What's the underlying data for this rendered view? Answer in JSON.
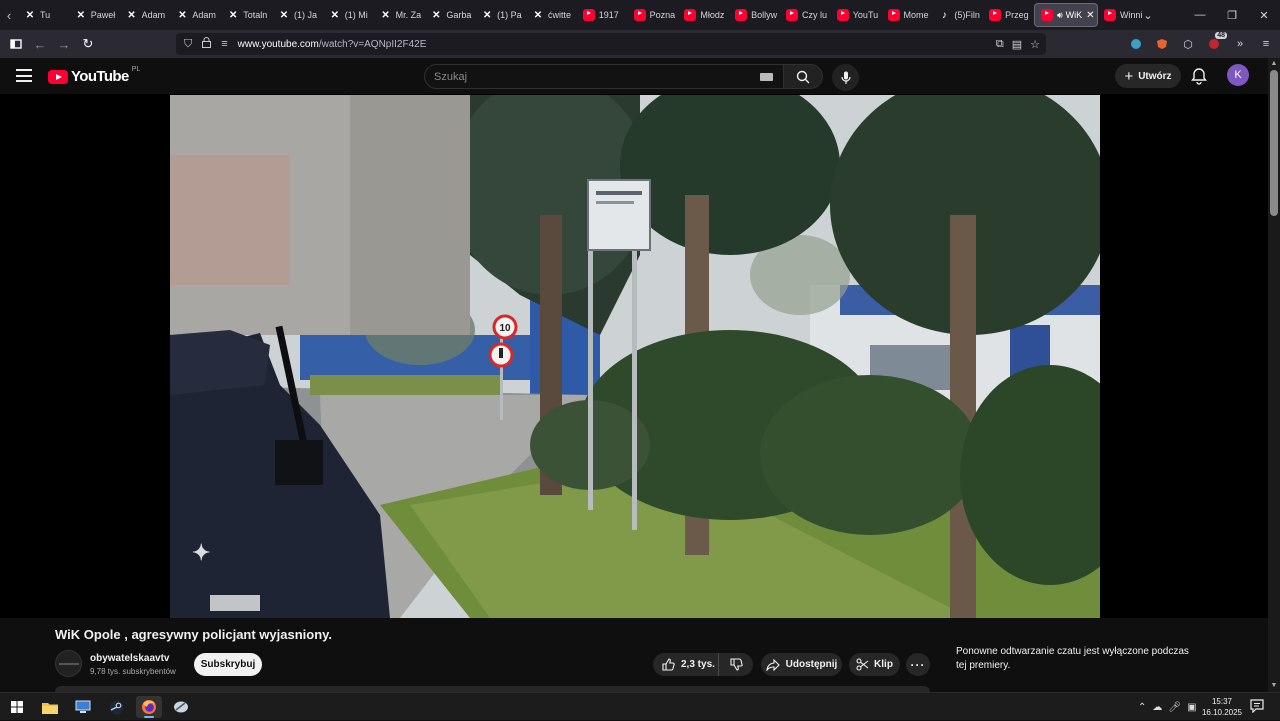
{
  "browser": {
    "tabs": [
      {
        "label": "Tu",
        "icon": "x-icon"
      },
      {
        "label": "Paweł",
        "icon": "x-icon"
      },
      {
        "label": "Adam",
        "icon": "x-icon"
      },
      {
        "label": "Adam",
        "icon": "x-icon"
      },
      {
        "label": "Totaln",
        "icon": "x-icon"
      },
      {
        "label": "(1) Ja",
        "icon": "x-icon"
      },
      {
        "label": "(1) Mi",
        "icon": "x-icon"
      },
      {
        "label": "Mr. Za",
        "icon": "x-icon"
      },
      {
        "label": "Garba",
        "icon": "x-icon"
      },
      {
        "label": "(1) Pa",
        "icon": "x-icon"
      },
      {
        "label": "ćwitte",
        "icon": "x-icon"
      },
      {
        "label": "1917",
        "icon": "youtube-icon"
      },
      {
        "label": "Pozna",
        "icon": "youtube-icon"
      },
      {
        "label": "Młodz",
        "icon": "youtube-icon"
      },
      {
        "label": "Bollyw",
        "icon": "youtube-icon"
      },
      {
        "label": "Czy lu",
        "icon": "youtube-icon"
      },
      {
        "label": "YouTu",
        "icon": "youtube-icon"
      },
      {
        "label": "Mome",
        "icon": "youtube-icon"
      },
      {
        "label": "(5)Filn",
        "icon": "tiktok-icon"
      },
      {
        "label": "Przeg",
        "icon": "youtube-icon"
      }
    ],
    "active_tab": {
      "label": "WiK",
      "icon": "youtube-icon"
    },
    "trailing_tab": {
      "label": "Winni",
      "icon": "youtube-icon"
    },
    "url_host": "www.youtube.com",
    "url_path": "/watch?v=AQNpII2F42E",
    "extension_badge": "48"
  },
  "youtube": {
    "logo_text": "YouTube",
    "country_code": "PL",
    "search_placeholder": "Szukaj",
    "create_label": "Utwórz",
    "avatar_letter": "K",
    "accent_color": "#ff0033"
  },
  "video": {
    "title": "WiK Opole , agresywny policjant wyjasniony.",
    "channel_name": "obywatelskaavtv",
    "subscribers": "9,78 tys. subskrybentów",
    "subscribe_label": "Subskrybuj",
    "likes": "2,3 tys.",
    "share_label": "Udostępnij",
    "clip_label": "Klip",
    "more_label": "···",
    "sign_speed": "10"
  },
  "chat": {
    "message": "Ponowne odtwarzanie czatu jest wyłączone podczas tej premiery."
  },
  "taskbar": {
    "time": "15:37",
    "date": "16.10.2025"
  }
}
